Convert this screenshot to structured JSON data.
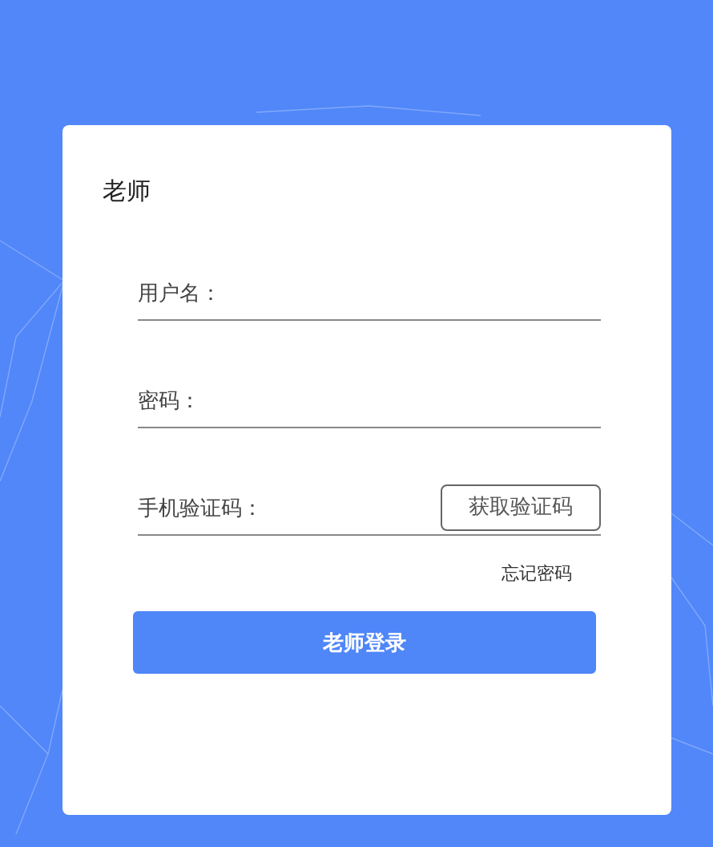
{
  "card": {
    "title": "老师"
  },
  "fields": [
    {
      "label": "用户名："
    },
    {
      "label": "密码："
    },
    {
      "label": "手机验证码：",
      "button": "获取验证码"
    }
  ],
  "forgot_link": "忘记密码",
  "login_button": "老师登录"
}
